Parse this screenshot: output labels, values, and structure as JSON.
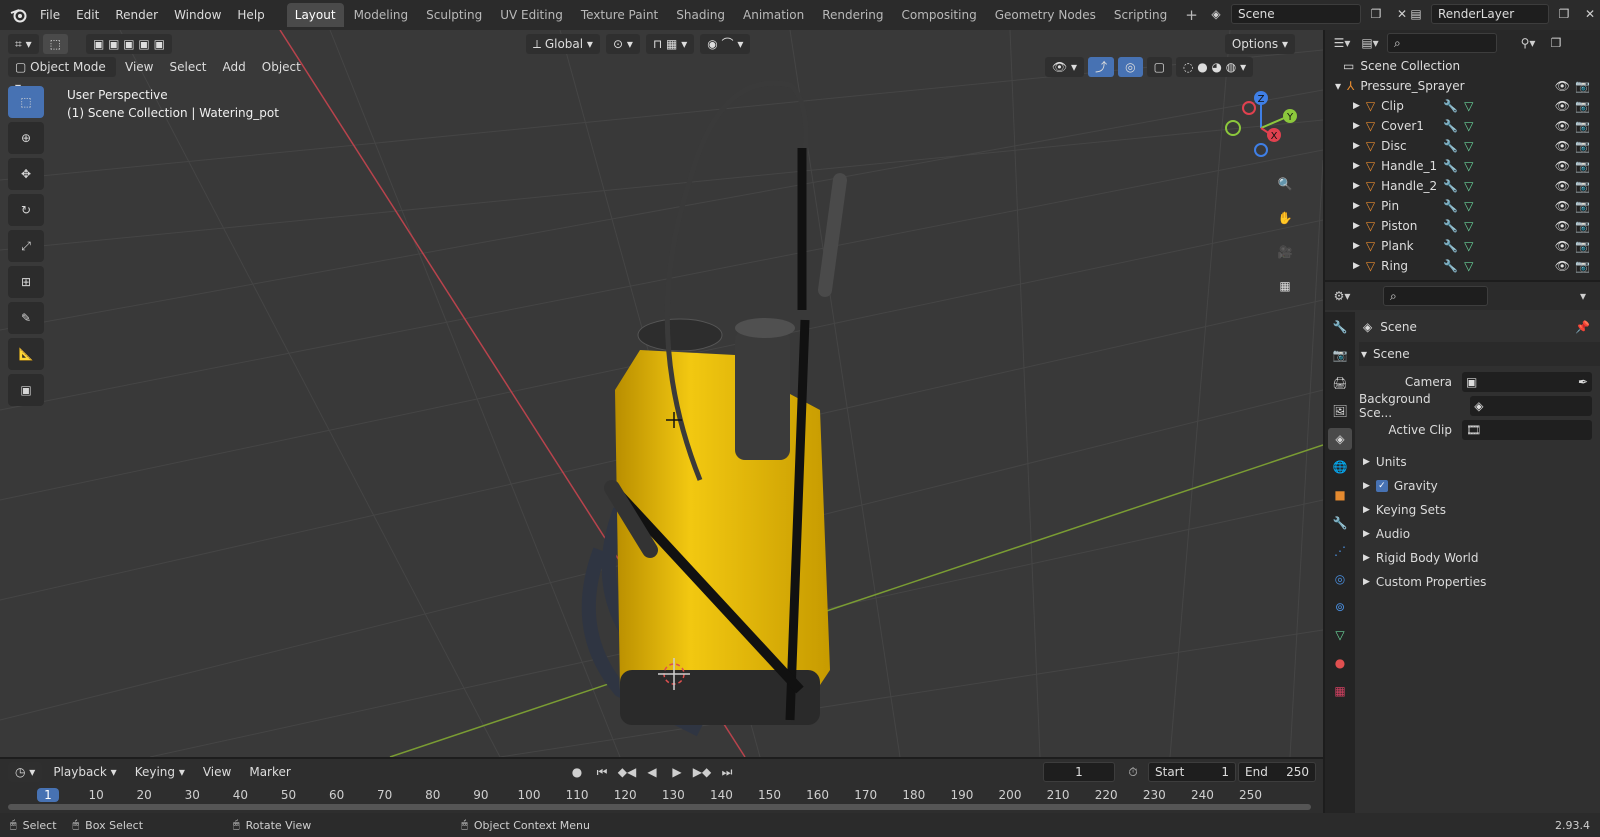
{
  "menu": [
    "File",
    "Edit",
    "Render",
    "Window",
    "Help"
  ],
  "workspaces": [
    "Layout",
    "Modeling",
    "Sculpting",
    "UV Editing",
    "Texture Paint",
    "Shading",
    "Animation",
    "Rendering",
    "Compositing",
    "Geometry Nodes",
    "Scripting"
  ],
  "active_workspace": "Layout",
  "scene_field": "Scene",
  "view_layer_field": "RenderLayer",
  "viewport": {
    "transform_orientation": "Global",
    "options_label": "Options",
    "mode": "Object Mode",
    "header_menus": [
      "View",
      "Select",
      "Add",
      "Object"
    ],
    "overlay_line1": "User Perspective",
    "overlay_line2": "(1) Scene Collection | Watering_pot",
    "gizmo_labels": {
      "x": "X",
      "y": "Y",
      "z": "Z"
    }
  },
  "outliner": {
    "root": "Scene Collection",
    "collection": "Pressure_Sprayer",
    "objects": [
      "Clip",
      "Cover1",
      "Disc",
      "Handle_1",
      "Handle_2",
      "Pin",
      "Piston",
      "Plank",
      "Ring"
    ]
  },
  "properties": {
    "context_title": "Scene",
    "section": "Scene",
    "camera_label": "Camera",
    "background_label": "Background Sce...",
    "active_clip_label": "Active Clip",
    "subpanels": [
      "Units",
      "Gravity",
      "Keying Sets",
      "Audio",
      "Rigid Body World",
      "Custom Properties"
    ],
    "gravity_checked": true
  },
  "timeline": {
    "menus": [
      "Playback",
      "Keying",
      "View",
      "Marker"
    ],
    "current_frame": "1",
    "start_label": "Start",
    "start_value": "1",
    "end_label": "End",
    "end_value": "250",
    "ruler": [
      "1",
      "10",
      "20",
      "30",
      "40",
      "50",
      "60",
      "70",
      "80",
      "90",
      "100",
      "110",
      "120",
      "130",
      "140",
      "150",
      "160",
      "170",
      "180",
      "190",
      "200",
      "210",
      "220",
      "230",
      "240",
      "250"
    ]
  },
  "statusbar": {
    "select": "Select",
    "box_select": "Box Select",
    "rotate_view": "Rotate View",
    "context_menu": "Object Context Menu",
    "version": "2.93.4"
  },
  "colors": {
    "accent": "#4772b3",
    "yellow": "#f2c811",
    "axis_x": "#e0414f",
    "axis_y": "#8cc83c",
    "axis_z": "#3f7fe6"
  }
}
